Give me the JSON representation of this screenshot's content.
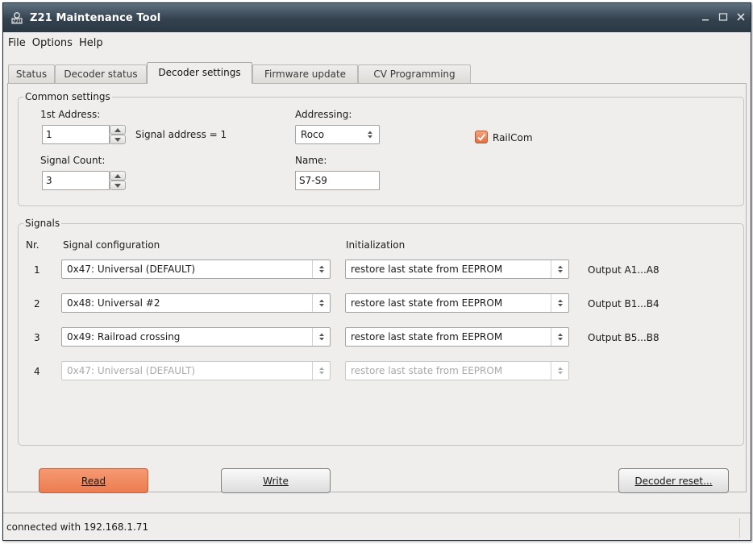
{
  "window": {
    "title": "Z21 Maintenance Tool"
  },
  "menu": [
    "File",
    "Options",
    "Help"
  ],
  "tabs": [
    "Status",
    "Decoder status",
    "Decoder settings",
    "Firmware update",
    "CV Programming"
  ],
  "common": {
    "group_title": "Common settings",
    "first_address_label": "1st Address:",
    "first_address_value": "1",
    "signal_address_text": "Signal address = 1",
    "signal_count_label": "Signal Count:",
    "signal_count_value": "3",
    "addressing_label": "Addressing:",
    "addressing_value": "Roco",
    "name_label": "Name:",
    "name_value": "S7-S9",
    "railcom_label": "RailCom",
    "railcom_checked": true
  },
  "signals": {
    "group_title": "Signals",
    "col_nr": "Nr.",
    "col_config": "Signal configuration",
    "col_init": "Initialization",
    "rows": [
      {
        "nr": "1",
        "config": "0x47: Universal (DEFAULT)",
        "init": "restore last state from EEPROM",
        "output": "Output A1...A8",
        "enabled": true
      },
      {
        "nr": "2",
        "config": "0x48: Universal #2",
        "init": "restore last state from EEPROM",
        "output": "Output B1...B4",
        "enabled": true
      },
      {
        "nr": "3",
        "config": "0x49: Railroad crossing",
        "init": "restore last state from EEPROM",
        "output": "Output B5...B8",
        "enabled": true
      },
      {
        "nr": "4",
        "config": "0x47: Universal (DEFAULT)",
        "init": "restore last state from EEPROM",
        "output": "",
        "enabled": false
      }
    ]
  },
  "buttons": {
    "read": "Read",
    "write": "Write",
    "reset": "Decoder reset..."
  },
  "status": {
    "text": "connected with 192.168.1.71"
  },
  "colors": {
    "accent": "#ec7c4f",
    "titlebar": "#34424f",
    "panel": "#efeeec"
  }
}
